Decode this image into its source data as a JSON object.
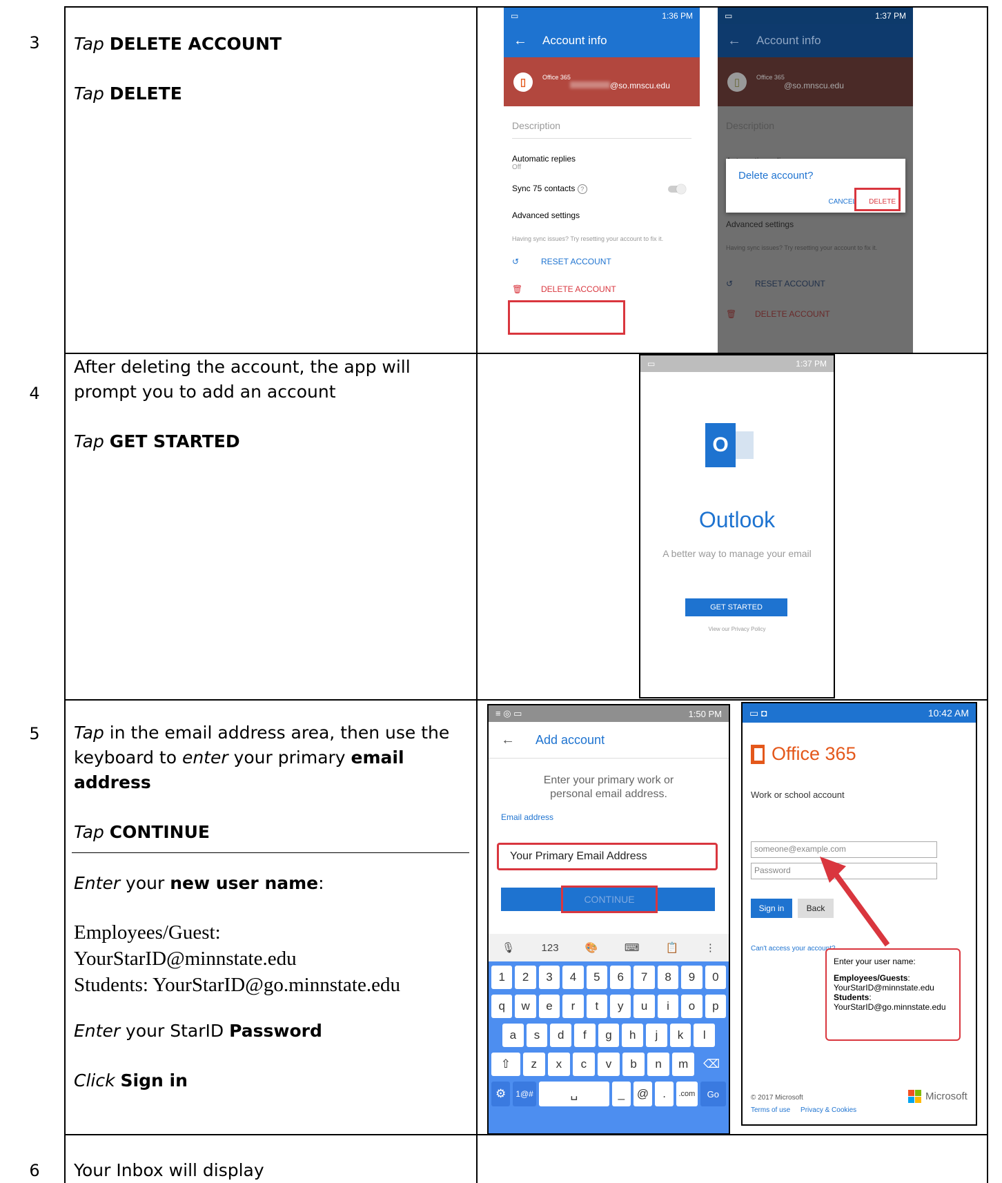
{
  "steps": [
    {
      "number": "3",
      "lines": [
        {
          "em": "Tap",
          "strong": "DELETE ACCOUNT"
        },
        {
          "em": "Tap",
          "strong": "DELETE"
        }
      ]
    },
    {
      "number": "4",
      "intro": "After deleting the account, the app will prompt you to add an account",
      "line": {
        "em": "Tap",
        "strong": "GET STARTED"
      }
    },
    {
      "number": "5",
      "p1": {
        "em1": "Tap",
        "t1": " in the email address area, then use the keyboard to ",
        "em2": "enter",
        "t2": " your primary ",
        "strong": "email address"
      },
      "p2": {
        "em": "Tap",
        "strong": "CONTINUE"
      },
      "p3": {
        "em": "Enter",
        "t": " your ",
        "strong": "new user name",
        "end": ":"
      },
      "serif1": "Employees/Guest:",
      "serif2": "YourStarID@minnstate.edu",
      "serif3": "Students: YourStarID@go.minnstate.edu",
      "p4": {
        "em": "Enter",
        "t": " your StarID ",
        "strong": "Password"
      },
      "p5": {
        "em": "Click",
        "strong": "Sign in"
      }
    },
    {
      "number": "6",
      "text": "Your Inbox will display"
    }
  ],
  "screen_account": {
    "time": "1:36 PM",
    "title": "Account info",
    "provider": "Office 365",
    "email": "@so.mnscu.edu",
    "description": "Description",
    "auto_replies": "Automatic replies",
    "auto_off": "Off",
    "sync": "Sync 75 contacts",
    "advanced": "Advanced settings",
    "sync_issue": "Having sync issues? Try resetting your account to fix it.",
    "reset": "RESET ACCOUNT",
    "delete": "DELETE ACCOUNT"
  },
  "screen_dialog": {
    "time": "1:37 PM",
    "title": "Account info",
    "provider": "Office 365",
    "email": "@so.mnscu.edu",
    "description": "Description",
    "auto_replies": "Automatic replies",
    "dialog_title": "Delete account?",
    "cancel": "CANCEL",
    "delete": "DELETE",
    "advanced": "Advanced settings",
    "sync_issue": "Having sync issues? Try resetting your account to fix it.",
    "reset": "RESET ACCOUNT",
    "delete_account": "DELETE ACCOUNT"
  },
  "screen_outlook": {
    "time": "1:37 PM",
    "logo_letter": "O",
    "name": "Outlook",
    "tagline": "A better way to manage your email",
    "get_started": "GET STARTED",
    "privacy": "View our Privacy Policy"
  },
  "screen_add": {
    "time": "1:50 PM",
    "title": "Add account",
    "prompt": "Enter your primary work or personal email address.",
    "field_label": "Email address",
    "field_value": "Your Primary Email Address",
    "continue": "CONTINUE",
    "kb_top": [
      "123"
    ],
    "row_num": [
      "1",
      "2",
      "3",
      "4",
      "5",
      "6",
      "7",
      "8",
      "9",
      "0"
    ],
    "row1": [
      "q",
      "w",
      "e",
      "r",
      "t",
      "y",
      "u",
      "i",
      "o",
      "p"
    ],
    "row2": [
      "a",
      "s",
      "d",
      "f",
      "g",
      "h",
      "j",
      "k",
      "l"
    ],
    "row3": [
      "z",
      "x",
      "c",
      "v",
      "b",
      "n",
      "m"
    ],
    "key_sym": "1@#",
    "key_at": "@",
    "key_dot": ".",
    "key_com": ".com",
    "key_go": "Go"
  },
  "screen_o365": {
    "time": "10:42 AM",
    "brand": "Office 365",
    "subtitle": "Work or school account",
    "email_placeholder": "someone@example.com",
    "password_placeholder": "Password",
    "sign_in": "Sign in",
    "back": "Back",
    "cant_access": "Can't access your account?",
    "callout_title": "Enter your user name:",
    "callout_emp": "Employees/Guests",
    "callout_emp_colon": ":",
    "callout_emp_val": "YourStarID@minnstate.edu",
    "callout_stu": "Students",
    "callout_stu_colon": ":",
    "callout_stu_val": "YourStarID@go.minnstate.edu",
    "copyright": "© 2017 Microsoft",
    "terms": "Terms of use",
    "privacy": "Privacy & Cookies",
    "ms": "Microsoft"
  },
  "colors": {
    "outlook_blue": "#1e73d0",
    "o365_orange": "#e4581b",
    "delete_red": "#d9363e",
    "key_blue": "#4d8ef0"
  }
}
